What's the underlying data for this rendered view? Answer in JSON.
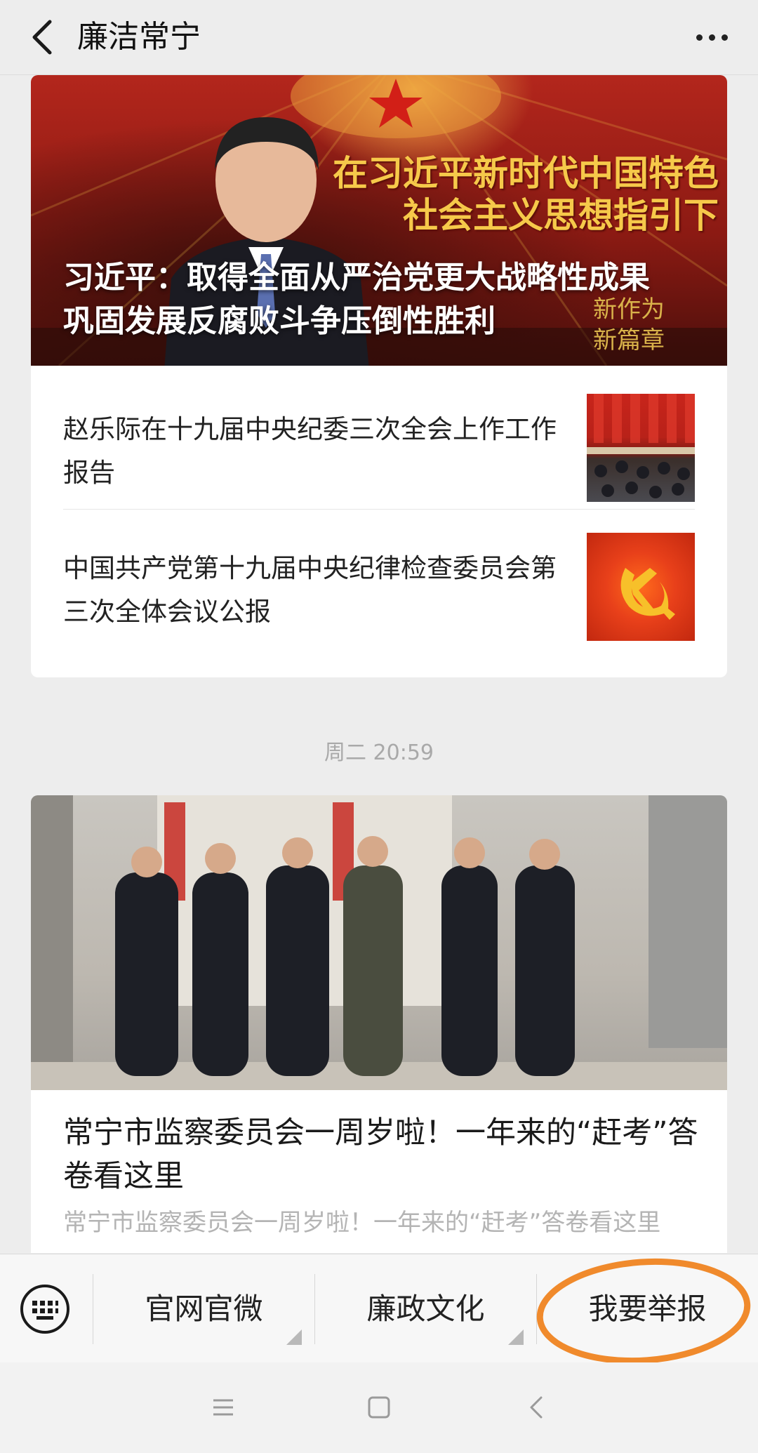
{
  "header": {
    "title": "廉洁常宁"
  },
  "card1": {
    "hero": {
      "slogan_line1": "在习近平新时代中国特色",
      "slogan_line2": "社会主义思想指引下",
      "small_line1": "新作为",
      "small_line2": "新篇章",
      "caption_line1": "习近平：取得全面从严治党更大战略性成果",
      "caption_line2": "巩固发展反腐败斗争压倒性胜利"
    },
    "items": [
      {
        "title": "赵乐际在十九届中央纪委三次全会上作工作报告"
      },
      {
        "title": "中国共产党第十九届中央纪律检查委员会第三次全体会议公报"
      }
    ]
  },
  "timestamp": "周二 20:59",
  "card2": {
    "title": "常宁市监察委员会一周岁啦！一年来的“赶考”答卷看这里",
    "summary": "常宁市监察委员会一周岁啦！一年来的“赶考”答卷看这里"
  },
  "menu": {
    "items": [
      {
        "label": "官网官微"
      },
      {
        "label": "廉政文化"
      },
      {
        "label": "我要举报"
      }
    ]
  },
  "colors": {
    "highlight": "#f08a2c",
    "background": "#ededed"
  }
}
